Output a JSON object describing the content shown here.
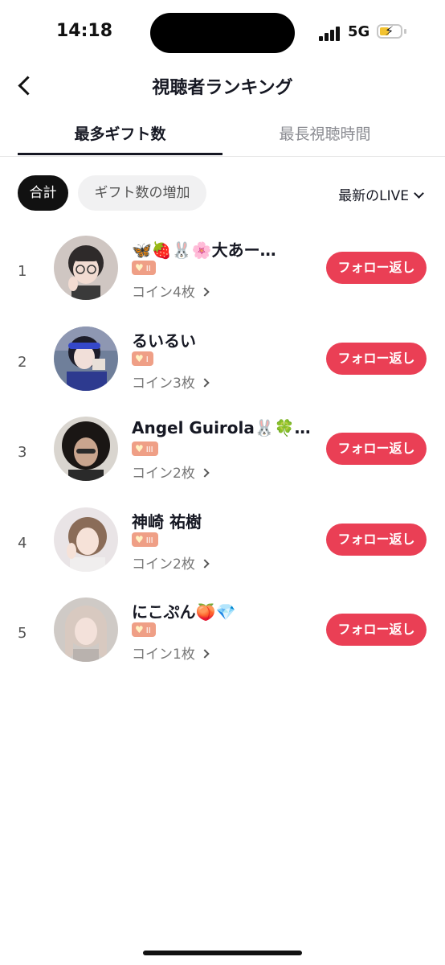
{
  "status_bar": {
    "time": "14:18",
    "network": "5G"
  },
  "header": {
    "title": "視聴者ランキング"
  },
  "tabs": [
    {
      "label": "最多ギフト数",
      "active": true
    },
    {
      "label": "最長視聴時間",
      "active": false
    }
  ],
  "filters": {
    "total": "合計",
    "increase": "ギフト数の増加",
    "live_select": "最新のLIVE"
  },
  "viewers": [
    {
      "rank": "1",
      "name": "🦋🍓🐰🌸大あー…",
      "level": "II",
      "coins": "コイン4枚",
      "button": "フォロー返し"
    },
    {
      "rank": "2",
      "name": "るいるい",
      "level": "I",
      "coins": "コイン3枚",
      "button": "フォロー返し"
    },
    {
      "rank": "3",
      "name": "Angel Guirola🐰🍀…",
      "level": "III",
      "coins": "コイン2枚",
      "button": "フォロー返し"
    },
    {
      "rank": "4",
      "name": "神崎 祐樹",
      "level": "III",
      "coins": "コイン2枚",
      "button": "フォロー返し"
    },
    {
      "rank": "5",
      "name": "にこぷん🍑💎",
      "level": "II",
      "coins": "コイン1枚",
      "button": "フォロー返し"
    }
  ],
  "colors": {
    "accent": "#ea3f55",
    "badge": "#ef9f86"
  }
}
